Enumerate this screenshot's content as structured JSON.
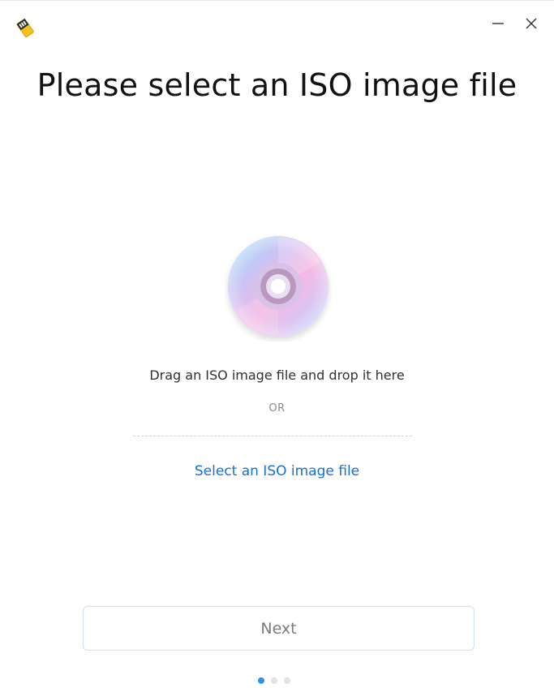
{
  "window": {
    "controls": {
      "minimize_icon": "minimize-icon",
      "close_icon": "close-icon"
    },
    "app_icon": "usb-drive-icon"
  },
  "page": {
    "title": "Please select an ISO image file",
    "drop_zone": {
      "icon": "disc-icon",
      "drag_text": "Drag an ISO image file and drop it here",
      "or_text": "OR",
      "select_link": "Select an ISO image file"
    },
    "next_button": "Next",
    "pager": {
      "current_step": 1,
      "total_steps": 3
    }
  },
  "colors": {
    "link": "#1470d6",
    "active_dot": "#2f8ff0",
    "inactive_dot": "#e3e3e3",
    "button_border": "#cfe0f2"
  }
}
